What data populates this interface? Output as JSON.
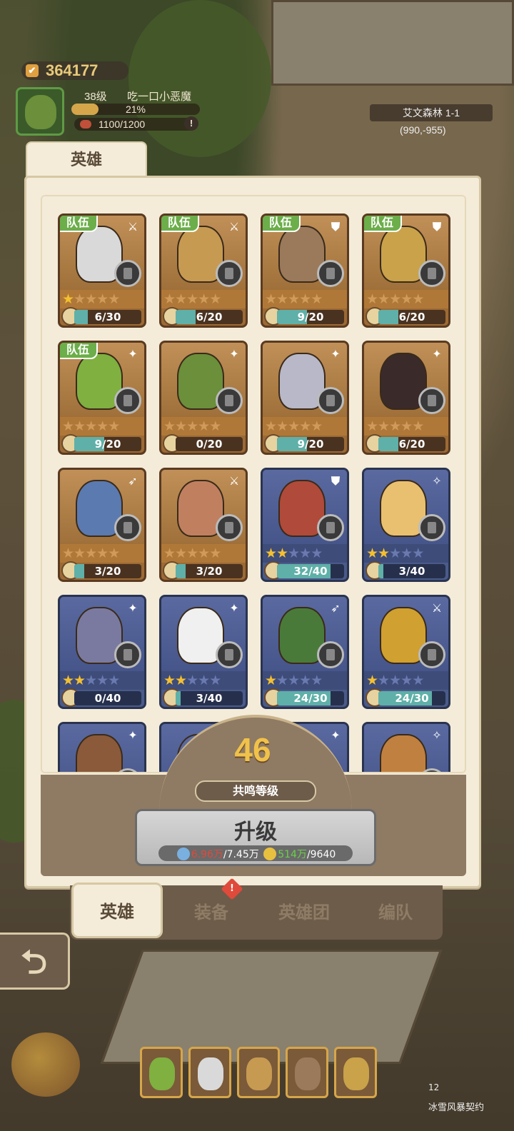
{
  "hud": {
    "score": "364177",
    "level": "38级",
    "player_name": "吃一口小恶魔",
    "xp_percent": "21%",
    "stamina": "1100/1200",
    "location": "艾文森林 1-1",
    "coords": "(990,-955)"
  },
  "panel": {
    "title": "英雄",
    "team_tag": "队伍",
    "heroes": [
      {
        "team": true,
        "cls": "⚔",
        "stars": 1,
        "max_stars": 5,
        "progress": "6/30",
        "frac": 0.2,
        "rarity": "gold",
        "color": "#d9d9d9"
      },
      {
        "team": true,
        "cls": "⚔",
        "stars": 0,
        "max_stars": 5,
        "progress": "6/20",
        "frac": 0.3,
        "rarity": "gold",
        "color": "#c79a52"
      },
      {
        "team": true,
        "cls": "⛊",
        "stars": 0,
        "max_stars": 5,
        "progress": "9/20",
        "frac": 0.45,
        "rarity": "gold",
        "color": "#9a7a5a"
      },
      {
        "team": true,
        "cls": "⛊",
        "stars": 0,
        "max_stars": 5,
        "progress": "6/20",
        "frac": 0.3,
        "rarity": "gold",
        "color": "#c9a24a"
      },
      {
        "team": true,
        "cls": "✦",
        "stars": 0,
        "max_stars": 5,
        "progress": "9/20",
        "frac": 0.45,
        "rarity": "gold",
        "color": "#7fb040"
      },
      {
        "team": false,
        "cls": "✦",
        "stars": 0,
        "max_stars": 5,
        "progress": "0/20",
        "frac": 0.0,
        "rarity": "gold",
        "color": "#6b8f3a"
      },
      {
        "team": false,
        "cls": "✦",
        "stars": 0,
        "max_stars": 5,
        "progress": "9/20",
        "frac": 0.45,
        "rarity": "gold",
        "color": "#b8b8c8"
      },
      {
        "team": false,
        "cls": "✦",
        "stars": 0,
        "max_stars": 5,
        "progress": "6/20",
        "frac": 0.3,
        "rarity": "gold",
        "color": "#3a2a2a"
      },
      {
        "team": false,
        "cls": "➶",
        "stars": 0,
        "max_stars": 5,
        "progress": "3/20",
        "frac": 0.15,
        "rarity": "gold",
        "color": "#5a7ab0"
      },
      {
        "team": false,
        "cls": "⚔",
        "stars": 0,
        "max_stars": 5,
        "progress": "3/20",
        "frac": 0.15,
        "rarity": "gold",
        "color": "#c08060"
      },
      {
        "team": false,
        "cls": "⛊",
        "stars": 2,
        "max_stars": 5,
        "progress": "32/40",
        "frac": 0.8,
        "rarity": "blue",
        "color": "#b04a3a"
      },
      {
        "team": false,
        "cls": "✧",
        "stars": 2,
        "max_stars": 5,
        "progress": "3/40",
        "frac": 0.075,
        "rarity": "blue",
        "color": "#e8c070"
      },
      {
        "team": false,
        "cls": "✦",
        "stars": 2,
        "max_stars": 5,
        "progress": "0/40",
        "frac": 0.0,
        "rarity": "blue",
        "color": "#7a7aa0"
      },
      {
        "team": false,
        "cls": "✦",
        "stars": 2,
        "max_stars": 5,
        "progress": "3/40",
        "frac": 0.075,
        "rarity": "blue",
        "color": "#f0f0f0"
      },
      {
        "team": false,
        "cls": "➶",
        "stars": 1,
        "max_stars": 5,
        "progress": "24/30",
        "frac": 0.8,
        "rarity": "blue",
        "color": "#4a7a3a"
      },
      {
        "team": false,
        "cls": "⚔",
        "stars": 1,
        "max_stars": 5,
        "progress": "24/30",
        "frac": 0.8,
        "rarity": "blue",
        "color": "#d0a030"
      },
      {
        "team": false,
        "cls": "✦",
        "stars": 0,
        "max_stars": 5,
        "progress": "",
        "frac": 0,
        "rarity": "blue",
        "color": "#8a5a3a"
      },
      {
        "team": false,
        "cls": "",
        "stars": 0,
        "max_stars": 5,
        "progress": "",
        "frac": 0,
        "rarity": "blue",
        "color": "#5a6aa0"
      },
      {
        "team": false,
        "cls": "✦",
        "stars": 0,
        "max_stars": 5,
        "progress": "",
        "frac": 0,
        "rarity": "blue",
        "color": "#5a6aa0"
      },
      {
        "team": false,
        "cls": "✧",
        "stars": 0,
        "max_stars": 5,
        "progress": "",
        "frac": 0,
        "rarity": "blue",
        "color": "#c08040"
      }
    ]
  },
  "resonance": {
    "level": "46",
    "label": "共鸣等级"
  },
  "upgrade": {
    "label": "升级",
    "cost1_have": "6.96万",
    "cost1_need": "/7.45万",
    "cost2_have": "514万",
    "cost2_need": "/9640"
  },
  "tabs": {
    "heroes": "英雄",
    "equipment": "装备",
    "hero_group": "英雄团",
    "formation": "编队",
    "alert": "!"
  },
  "back": "⮌",
  "bottom": {
    "pact_count": "12",
    "pact_label": "冰雪风暴契约"
  }
}
